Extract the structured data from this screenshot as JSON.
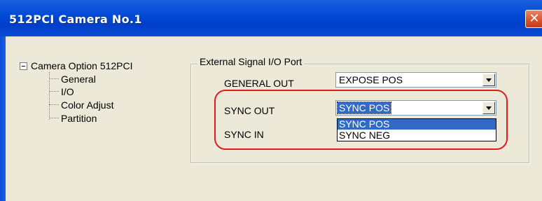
{
  "window": {
    "title": "512PCI  Camera  No.1",
    "close_symbol": "✕",
    "close_icon": "close-icon"
  },
  "tree": {
    "root_label": "Camera Option 512PCI",
    "expander_icon": "minus-box-icon",
    "items": [
      {
        "label": "General"
      },
      {
        "label": "I/O"
      },
      {
        "label": "Color Adjust"
      },
      {
        "label": "Partition"
      }
    ]
  },
  "io_group": {
    "legend": "External Signal I/O Port",
    "general_out": {
      "label": "GENERAL OUT",
      "value": "EXPOSE POS"
    },
    "sync_out": {
      "label": "SYNC OUT",
      "value": "SYNC POS"
    },
    "sync_in": {
      "label": "SYNC IN"
    },
    "dropdown_options": [
      "SYNC POS",
      "SYNC NEG"
    ],
    "highlight_color": "#e31b1b"
  },
  "colors": {
    "titlebar": "#0047d6",
    "selection": "#316ac5",
    "dialog_bg": "#ece9d8"
  }
}
